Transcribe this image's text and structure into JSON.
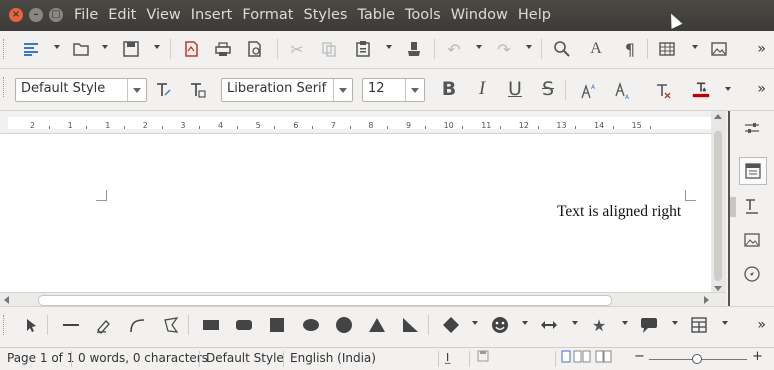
{
  "menu": [
    "File",
    "Edit",
    "View",
    "Insert",
    "Format",
    "Styles",
    "Table",
    "Tools",
    "Window",
    "Help"
  ],
  "window_buttons": {
    "close": "×",
    "minimize": "–",
    "maximize": "□"
  },
  "toolbar1": {
    "icons": [
      "new-document-icon",
      "open-folder-icon",
      "save-icon",
      "export-pdf-icon",
      "print-icon",
      "print-preview-icon",
      "cut-icon",
      "copy-icon",
      "paste-icon",
      "clone-formatting-icon",
      "undo-icon",
      "redo-icon",
      "find-replace-icon",
      "spelling-icon",
      "formatting-marks-icon",
      "insert-table-icon",
      "insert-image-icon"
    ]
  },
  "toolbar2": {
    "paragraph_style": "Default Style",
    "font_name": "Liberation Serif",
    "font_size": "12",
    "bold": "B",
    "italic": "I",
    "underline": "U",
    "strikethrough": "S",
    "font_color": "#c00000"
  },
  "ruler": {
    "numbers": [
      "2",
      "1",
      "1",
      "2",
      "3",
      "4",
      "5",
      "6",
      "7",
      "8",
      "9",
      "10",
      "11",
      "12",
      "13",
      "14",
      "15"
    ]
  },
  "document": {
    "text": "Text is aligned right"
  },
  "sidebar": {
    "icons": [
      "properties-icon",
      "page-icon",
      "styles-icon",
      "gallery-icon",
      "navigator-icon"
    ]
  },
  "drawbar": {
    "icons": [
      "select-pointer-icon",
      "line-icon",
      "freeform-icon",
      "curve-icon",
      "polygon-icon",
      "rectangle-icon",
      "rounded-rectangle-icon",
      "square-icon",
      "ellipse-icon",
      "circle-icon",
      "triangle-icon",
      "right-triangle-icon",
      "basic-shapes-icon",
      "symbol-shapes-icon",
      "block-arrows-icon",
      "stars-icon",
      "callouts-icon",
      "flowchart-icon"
    ]
  },
  "status": {
    "page": "Page 1 of 1",
    "words": "0 words, 0 characters",
    "style": "Default Style",
    "language": "English (India)"
  }
}
